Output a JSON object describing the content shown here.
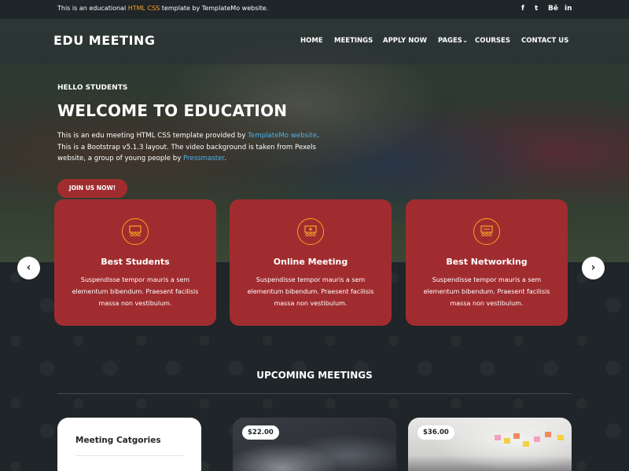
{
  "topbar": {
    "text_before": "This is an educational ",
    "text_accent": "HTML CSS",
    "text_after": " template by TemplateMo website.",
    "social_icons": [
      "facebook-icon",
      "twitter-icon",
      "behance-icon",
      "linkedin-icon"
    ],
    "social_glyphs": [
      "f",
      "t",
      "Bē",
      "in"
    ]
  },
  "brand": "EDU MEETING",
  "nav": {
    "items": [
      "HOME",
      "MEETINGS",
      "APPLY NOW",
      "PAGES",
      "COURSES",
      "CONTACT US"
    ],
    "dropdown_indicator": "⌄"
  },
  "hero": {
    "kicker": "HELLO STUDENTS",
    "title": "WELCOME TO EDUCATION",
    "desc_1": "This is an edu meeting HTML CSS template provided by ",
    "desc_link_1": "TemplateMo website",
    "desc_2": ". This is a Bootstrap v5.1.3 layout. The video background is taken from Pexels website, a group of young people by ",
    "desc_link_2": "Pressmaster",
    "desc_3": ".",
    "button": "JOIN US NOW!"
  },
  "carousel": {
    "prev": "‹",
    "next": "›"
  },
  "cards": [
    {
      "title": "Best Students",
      "text": "Suspendisse tempor mauris a sem elementum bibendum. Praesent facilisis massa non vestibulum.",
      "icon": "students-icon"
    },
    {
      "title": "Online Meeting",
      "text": "Suspendisse tempor mauris a sem elementum bibendum. Praesent facilisis massa non vestibulum.",
      "icon": "meeting-icon"
    },
    {
      "title": "Best Networking",
      "text": "Suspendisse tempor mauris a sem elementum bibendum. Praesent facilisis massa non vestibulum.",
      "icon": "networking-icon"
    }
  ],
  "upcoming": {
    "title": "UPCOMING MEETINGS",
    "categories_title": "Meeting Catgories",
    "meetings": [
      {
        "price": "$22.00"
      },
      {
        "price": "$36.00"
      }
    ]
  },
  "colors": {
    "accent_red": "#a12c2f",
    "accent_orange": "#f5a425",
    "dark": "#1f2528",
    "link_blue": "#4fb0e6"
  }
}
